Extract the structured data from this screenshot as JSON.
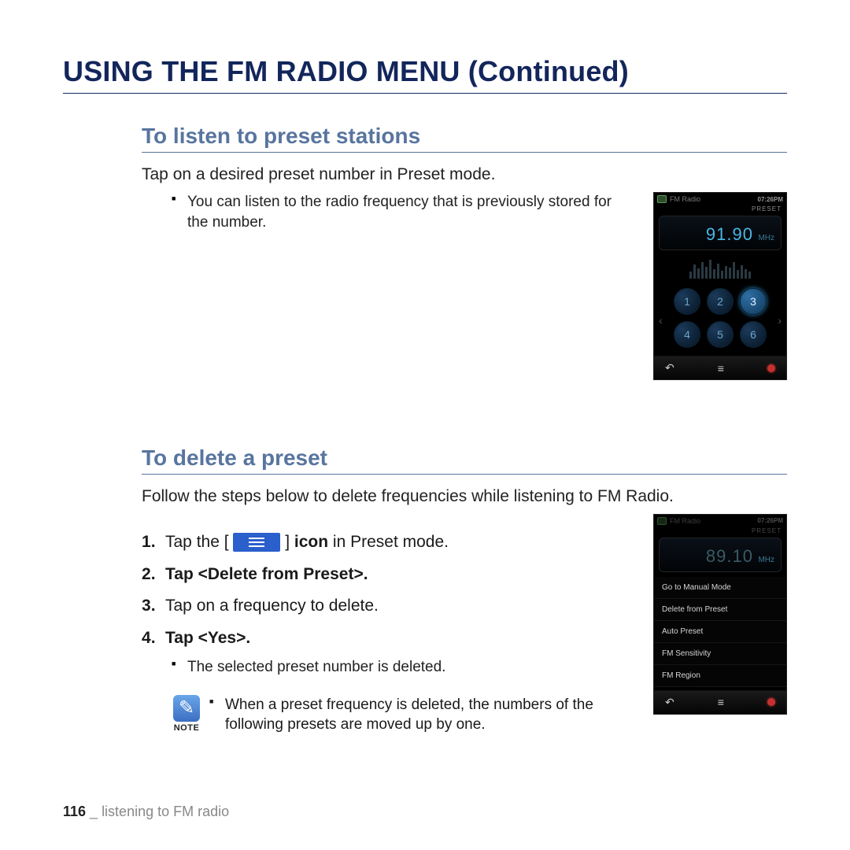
{
  "page_title": "USING THE FM RADIO MENU (Continued)",
  "section1": {
    "title": "To listen to preset stations",
    "intro": "Tap on a desired preset number in Preset mode.",
    "bullet": "You can listen to the radio frequency that is previously stored for the number."
  },
  "section2": {
    "title": "To delete a preset",
    "intro": "Follow the steps below to delete frequencies while listening to FM Radio.",
    "step1_a": "Tap the [",
    "step1_b": "] ",
    "step1_icon_word": "icon",
    "step1_c": " in Preset mode.",
    "step2": "Tap <Delete from Preset>.",
    "step3": "Tap on a frequency to delete.",
    "step4": "Tap <Yes>.",
    "sub_bullet": "The selected preset number is deleted.",
    "note_label": "NOTE",
    "note_text": "When a preset frequency is deleted, the numbers of the following presets are moved up by one."
  },
  "device1": {
    "app": "FM Radio",
    "time": "07:26PM",
    "mode": "PRESET",
    "freq": "91.90",
    "unit": "MHz",
    "presets": [
      "1",
      "2",
      "3",
      "4",
      "5",
      "6"
    ],
    "active": "3"
  },
  "device2": {
    "app": "FM Radio",
    "time": "07:26PM",
    "mode": "PRESET",
    "freq": "89.10",
    "unit": "MHz",
    "menu": [
      "Go to Manual Mode",
      "Delete from Preset",
      "Auto Preset",
      "FM Sensitivity",
      "FM Region"
    ]
  },
  "footer": {
    "page": "116",
    "sep": " _ ",
    "chapter": "listening to FM radio"
  }
}
